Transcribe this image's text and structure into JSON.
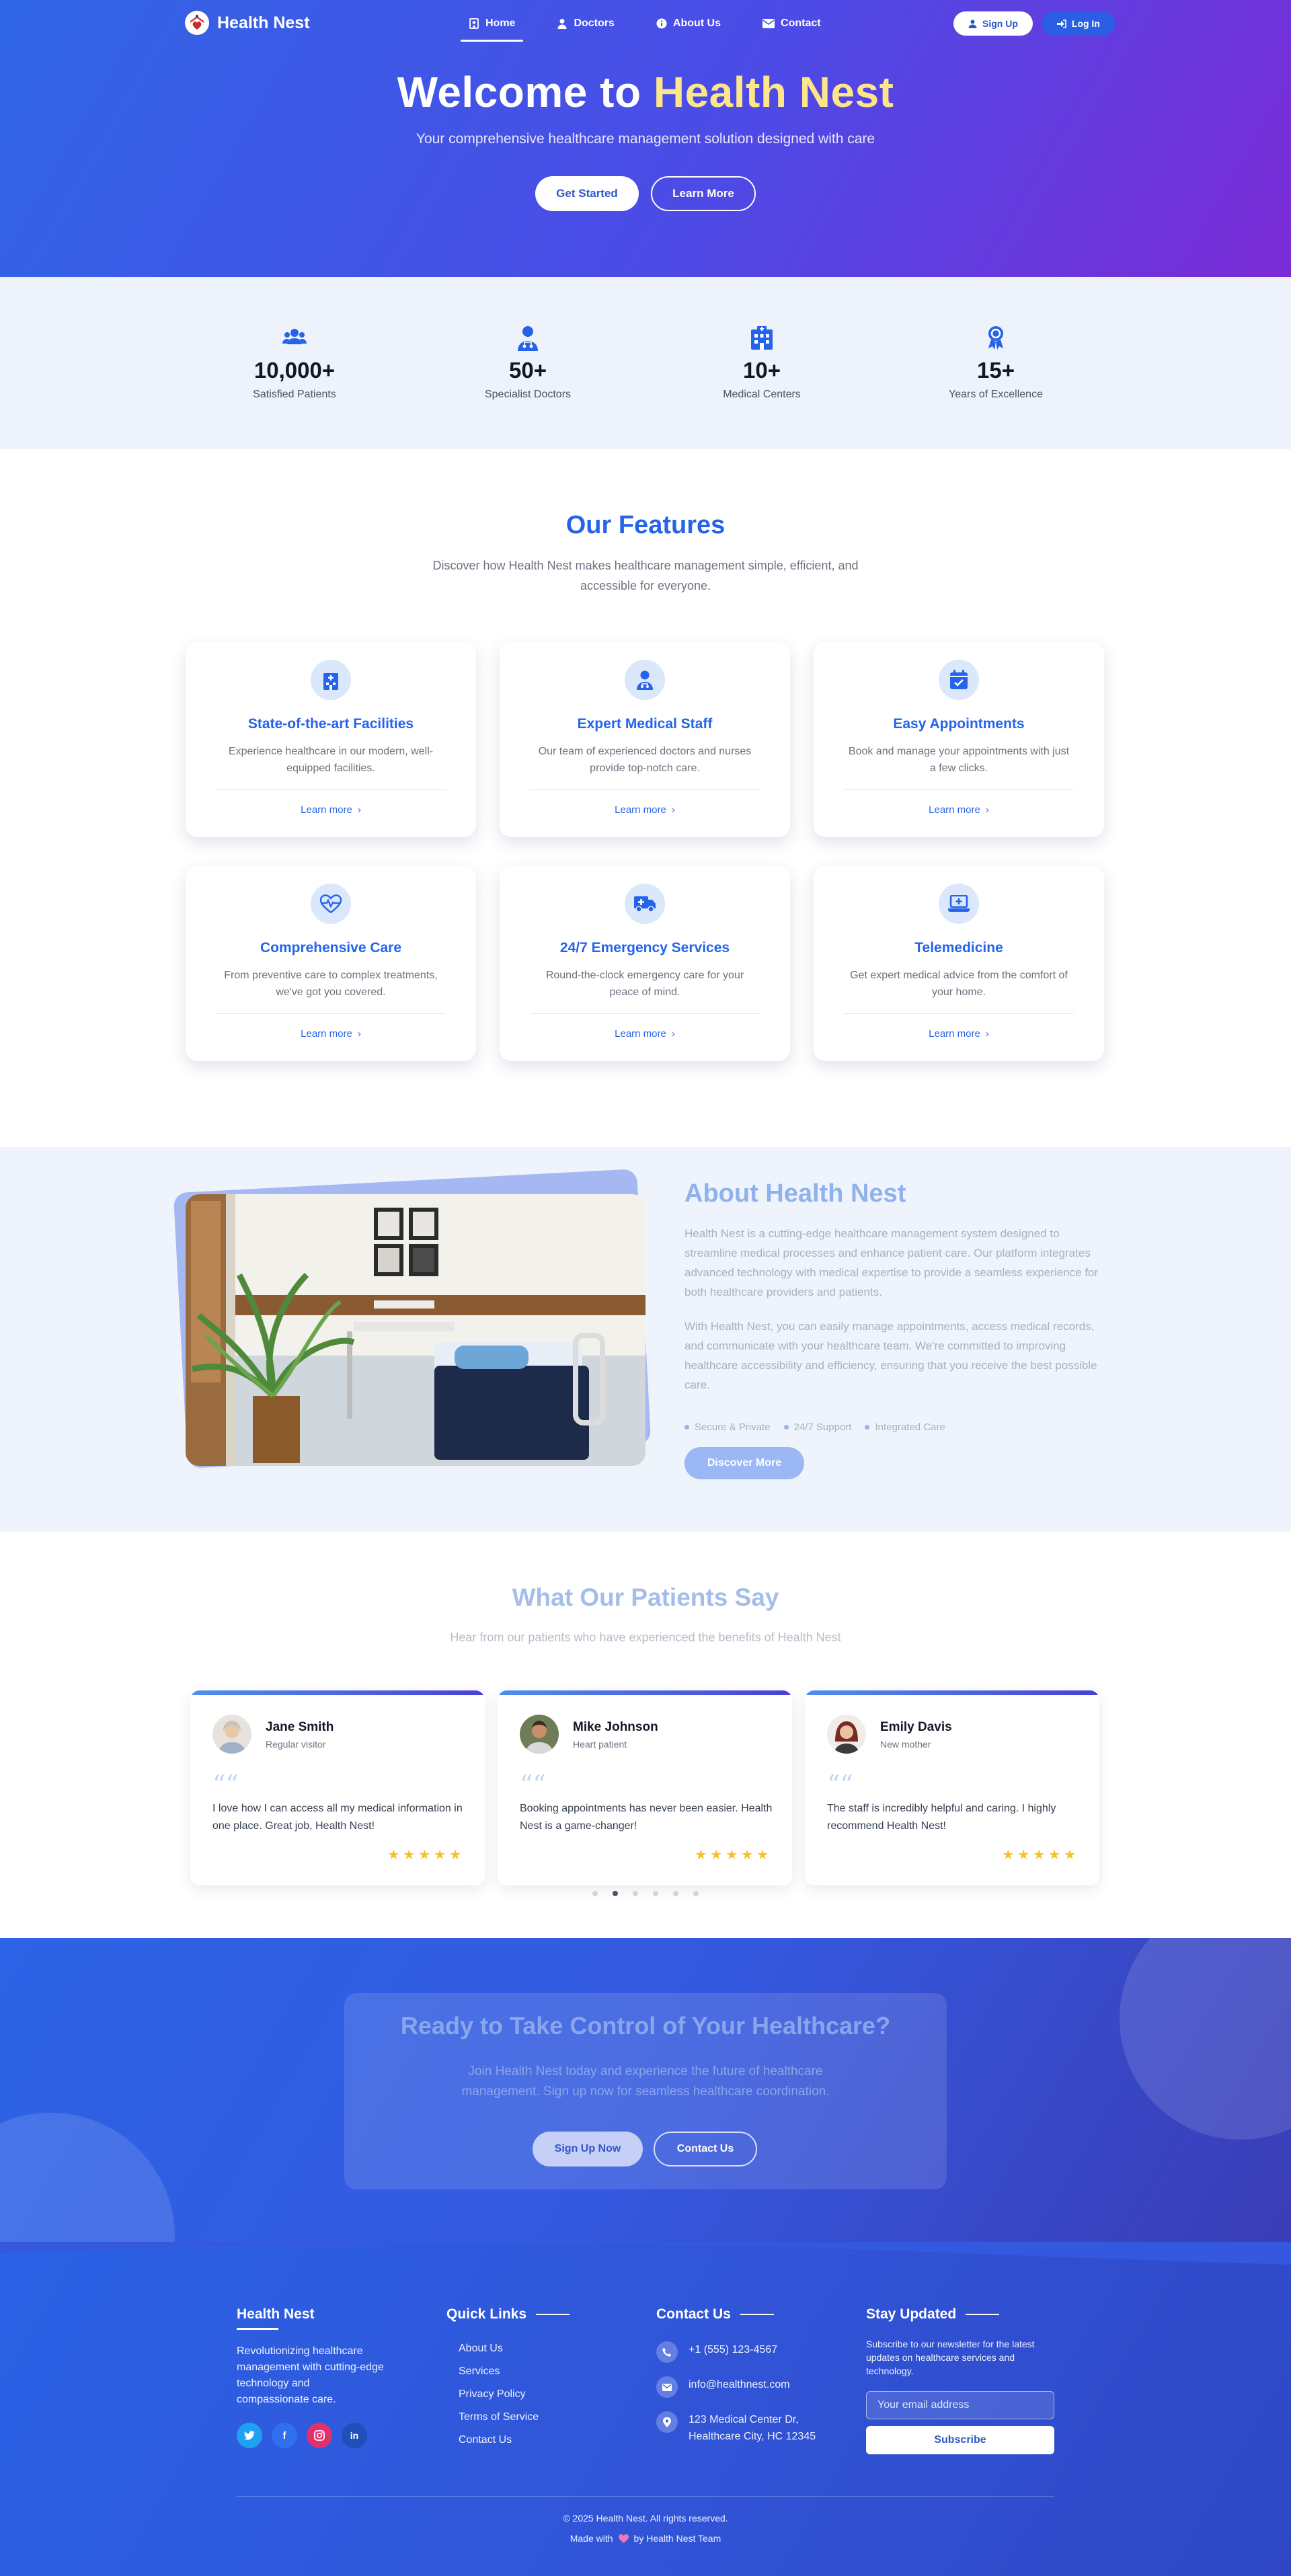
{
  "nav": {
    "brand": "Health Nest",
    "items": [
      {
        "label": "Home",
        "icon": "hospital-icon",
        "active": true
      },
      {
        "label": "Doctors",
        "icon": "doctor-icon"
      },
      {
        "label": "About Us",
        "icon": "info-icon"
      },
      {
        "label": "Contact",
        "icon": "envelope-icon"
      }
    ],
    "signup": "Sign Up",
    "login": "Log In"
  },
  "hero": {
    "title_prefix": "Welcome to ",
    "title_highlight": "Health Nest",
    "subtitle": "Your comprehensive healthcare management solution designed with care",
    "primary": "Get Started",
    "secondary": "Learn More"
  },
  "stats": [
    {
      "value": "10,000+",
      "label": "Satisfied Patients",
      "icon": "users-icon"
    },
    {
      "value": "50+",
      "label": "Specialist Doctors",
      "icon": "doctor-icon"
    },
    {
      "value": "10+",
      "label": "Medical Centers",
      "icon": "building-icon"
    },
    {
      "value": "15+",
      "label": "Years of Excellence",
      "icon": "award-icon"
    }
  ],
  "features": {
    "title": "Our Features",
    "subtitle": "Discover how Health Nest makes healthcare management simple, efficient, and accessible for everyone.",
    "more": "Learn more",
    "cards": [
      {
        "title": "State-of-the-art Facilities",
        "text": "Experience healthcare in our modern, well-equipped facilities.",
        "icon": "hospital-icon"
      },
      {
        "title": "Expert Medical Staff",
        "text": "Our team of experienced doctors and nurses provide top-notch care.",
        "icon": "doctor-icon"
      },
      {
        "title": "Easy Appointments",
        "text": "Book and manage your appointments with just a few clicks.",
        "icon": "calendar-check-icon"
      },
      {
        "title": "Comprehensive Care",
        "text": "From preventive care to complex treatments, we've got you covered.",
        "icon": "heart-pulse-icon"
      },
      {
        "title": "24/7 Emergency Services",
        "text": "Round-the-clock emergency care for your peace of mind.",
        "icon": "ambulance-icon"
      },
      {
        "title": "Telemedicine",
        "text": "Get expert medical advice from the comfort of your home.",
        "icon": "laptop-medical-icon"
      }
    ]
  },
  "about": {
    "title": "About Health Nest",
    "p1": "Health Nest is a cutting-edge healthcare management system designed to streamline medical processes and enhance patient care. Our platform integrates advanced technology with medical expertise to provide a seamless experience for both healthcare providers and patients.",
    "p2": "With Health Nest, you can easily manage appointments, access medical records, and communicate with your healthcare team. We're committed to improving healthcare accessibility and efficiency, ensuring that you receive the best possible care.",
    "tags": [
      "Secure & Private",
      "24/7 Support",
      "Integrated Care"
    ],
    "button": "Discover More"
  },
  "testimonials": {
    "title": "What Our Patients Say",
    "subtitle": "Hear from our patients who have experienced the benefits of Health Nest",
    "items": [
      {
        "name": "Jane Smith",
        "role": "Regular visitor",
        "text": "I love how I can access all my medical information in one place. Great job, Health Nest!",
        "stars": "★★★★★"
      },
      {
        "name": "Mike Johnson",
        "role": "Heart patient",
        "text": "Booking appointments has never been easier. Health Nest is a game-changer!",
        "stars": "★★★★★"
      },
      {
        "name": "Emily Davis",
        "role": "New mother",
        "text": "The staff is incredibly helpful and caring. I highly recommend Health Nest!",
        "stars": "★★★★★"
      }
    ],
    "quote_mark": "““"
  },
  "cta": {
    "title": "Ready to Take Control of Your Healthcare?",
    "text": "Join Health Nest today and experience the future of healthcare management. Sign up now for seamless healthcare coordination.",
    "primary": "Sign Up Now",
    "secondary": "Contact Us"
  },
  "footer": {
    "brand": "Health Nest",
    "desc": "Revolutionizing healthcare management with cutting-edge technology and compassionate care.",
    "social": [
      "twitter-icon",
      "facebook-icon",
      "instagram-icon",
      "linkedin-icon"
    ],
    "quick_title": "Quick Links",
    "links": [
      "About Us",
      "Services",
      "Privacy Policy",
      "Terms of Service",
      "Contact Us"
    ],
    "contact_title": "Contact Us",
    "phone": "+1 (555) 123-4567",
    "email": "info@healthnest.com",
    "address": "123 Medical Center Dr, Healthcare City, HC 12345",
    "news_title": "Stay Updated",
    "news_text": "Subscribe to our newsletter for the latest updates on healthcare services and technology.",
    "news_placeholder": "Your email address",
    "news_button": "Subscribe",
    "copyright": "© 2025 Health Nest. All rights reserved.",
    "made_prefix": "Made with",
    "made_suffix": "by Health Nest Team"
  },
  "colors": {
    "primary": "#2563eb",
    "accent": "#fde68a",
    "star": "#fbbf24"
  }
}
